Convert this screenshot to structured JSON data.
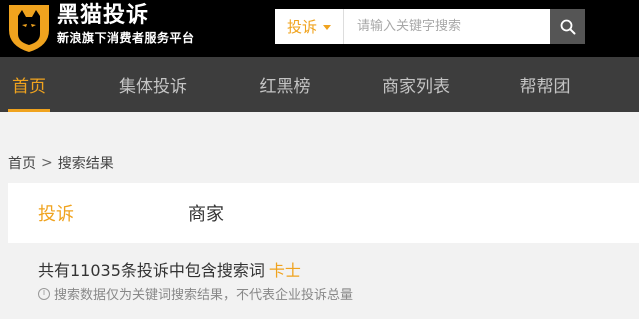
{
  "header": {
    "brand_name": "黑猫投诉",
    "slogan": "新浪旗下消费者服务平台",
    "logo_icon": "black-cat-shield-icon"
  },
  "search": {
    "type_label": "投诉",
    "placeholder": "请输入关键字搜索",
    "value": "",
    "button_icon": "search-icon"
  },
  "nav": {
    "items": [
      {
        "label": "首页",
        "active": true
      },
      {
        "label": "集体投诉",
        "active": false
      },
      {
        "label": "红黑榜",
        "active": false
      },
      {
        "label": "商家列表",
        "active": false
      },
      {
        "label": "帮帮团",
        "active": false
      }
    ]
  },
  "breadcrumb": {
    "home": "首页",
    "separator": ">",
    "current": "搜索结果"
  },
  "result_tabs": [
    {
      "label": "投诉",
      "active": true
    },
    {
      "label": "商家",
      "active": false
    }
  ],
  "results": {
    "count_prefix": "共有11035条投诉中包含搜索词",
    "keyword": "卡士",
    "disclaimer": "搜索数据仅为关键词搜索结果，不代表企业投诉总量",
    "info_icon": "info-icon"
  },
  "colors": {
    "accent": "#f0a31e",
    "header_bg": "#000000",
    "nav_bg": "#3d3d3d",
    "page_bg": "#f2f2f2"
  }
}
